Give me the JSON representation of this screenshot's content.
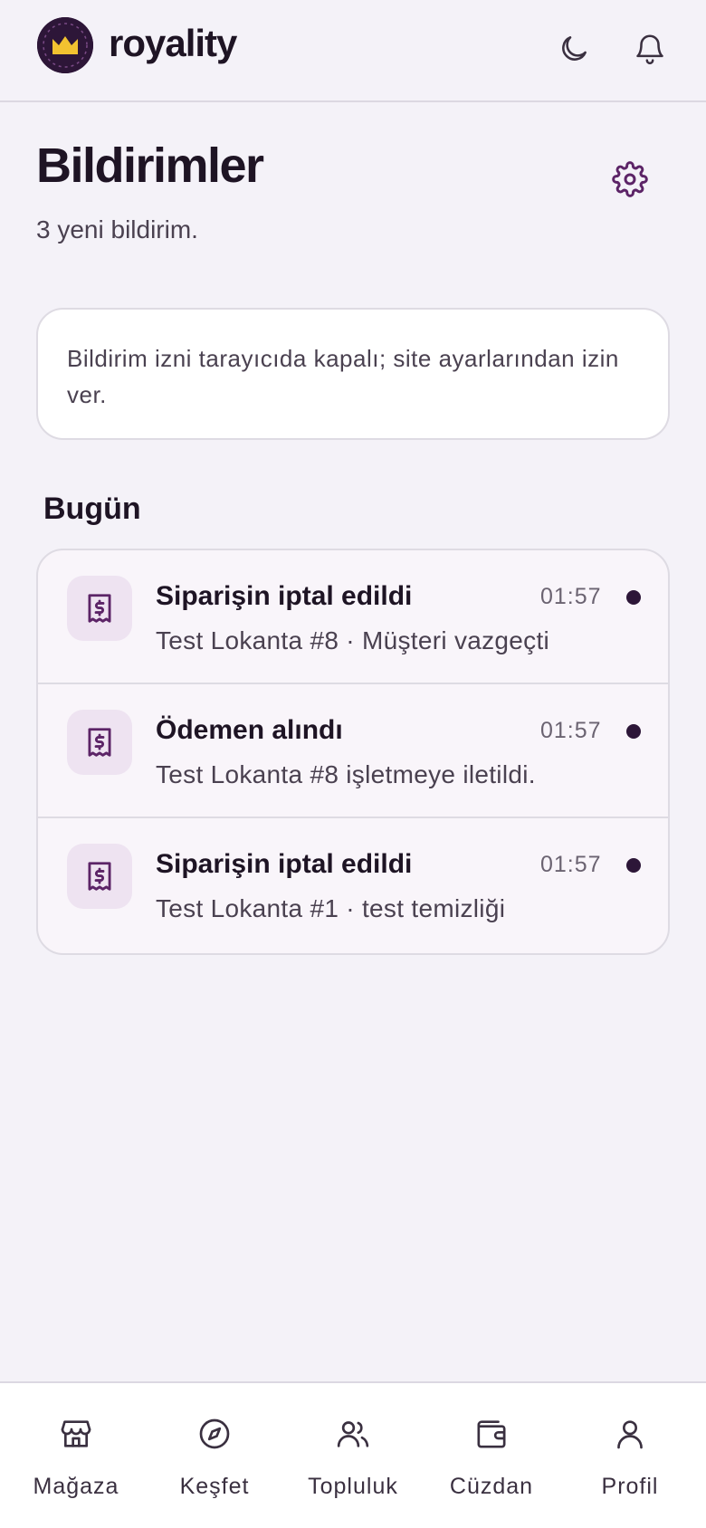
{
  "header": {
    "brand": "royality"
  },
  "page": {
    "title": "Bildirimler",
    "subtitle": "3 yeni bildirim."
  },
  "permission_notice": "Bildirim izni tarayıcıda kapalı; site ayarlarından izin ver.",
  "section": {
    "label": "Bugün"
  },
  "notifications": [
    {
      "title": "Siparişin iptal edildi",
      "time": "01:57",
      "body": "Test Lokanta #8 · Müşteri vazgeçti",
      "unread": true
    },
    {
      "title": "Ödemen alındı",
      "time": "01:57",
      "body": "Test Lokanta #8 işletmeye iletildi.",
      "unread": true
    },
    {
      "title": "Siparişin iptal edildi",
      "time": "01:57",
      "body": "Test Lokanta #1 · test temizliği",
      "unread": true
    }
  ],
  "bottom_nav": [
    {
      "label": "Mağaza",
      "icon": "store-icon"
    },
    {
      "label": "Keşfet",
      "icon": "compass-icon"
    },
    {
      "label": "Topluluk",
      "icon": "users-icon"
    },
    {
      "label": "Cüzdan",
      "icon": "wallet-icon"
    },
    {
      "label": "Profil",
      "icon": "user-icon"
    }
  ],
  "colors": {
    "accent": "#2d1638",
    "icon_purple": "#5c2467",
    "crown": "#f2c230",
    "background": "#f4f2f8"
  }
}
